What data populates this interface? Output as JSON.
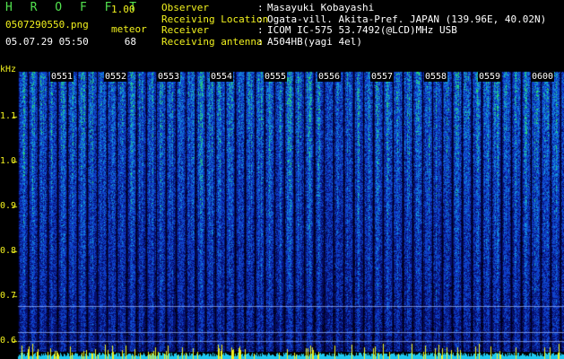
{
  "header": {
    "app_title": "H R O F F T",
    "app_version": "1.00",
    "file_name": "0507290550.png",
    "meteor_label": "meteor",
    "date_time": "05.07.29 05:50",
    "meteor_count": "68"
  },
  "info": [
    {
      "key": "Observer",
      "value": "Masayuki Kobayashi"
    },
    {
      "key": "Receiving Location",
      "value": "Ogata-vill. Akita-Pref. JAPAN (139.96E, 40.02N)"
    },
    {
      "key": "Receiver",
      "value": "ICOM IC-575 53.7492(@LCD)MHz USB"
    },
    {
      "key": "Receiving antenna",
      "value": "A504HB(yagi 4el)"
    }
  ],
  "info_separator": ":",
  "axis": {
    "unit": "kHz",
    "y_ticks": [
      "1.1",
      "1.0",
      "0.9",
      "0.8",
      "0.7",
      "0.6"
    ],
    "y_values": [
      1.1,
      1.0,
      0.9,
      0.8,
      0.7,
      0.6
    ],
    "time_ticks": [
      "0551",
      "0552",
      "0553",
      "0554",
      "0555",
      "0556",
      "0557",
      "0558",
      "0559",
      "0600"
    ]
  },
  "colors": {
    "background": "#000000",
    "label_green": "#52e24e",
    "label_yellow": "#f2f21e",
    "signal_low": "#08105a",
    "signal_mid": "#1a4ed0",
    "signal_high": "#2fd37a",
    "baseline_cyan": "#1ec8f0",
    "spike_yellow": "#f2f21e"
  }
}
